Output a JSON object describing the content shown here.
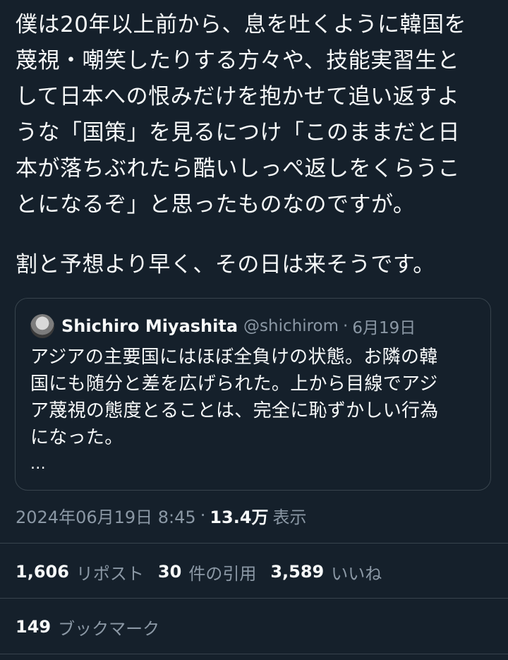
{
  "post": {
    "text_lines": [
      "僕は20年以上前から、息を吐くように韓国を",
      "蔑視・嘲笑したりする方々や、技能実習生と",
      "して日本への恨みだけを抱かせて追い返すよ",
      "うな「国策」を見るにつけ「このままだと日",
      "本が落ちぶれたら酷いしっぺ返しをくらうこ",
      "とになるぞ」と思ったものなのですが。",
      "割と予想より早く、その日は来そうです。"
    ]
  },
  "quote": {
    "author_name": "Shichiro Miyashita",
    "handle": "@shichirom",
    "separator": "·",
    "date": "6月19日",
    "text_lines": [
      "アジアの主要国にはほぼ全負けの状態。お隣の韓",
      "国にも随分と差を広げられた。上から目線でアジ",
      "ア蔑視の態度とることは、完全に恥ずかしい行為",
      "になった。",
      "..."
    ]
  },
  "meta": {
    "timestamp": "2024年06月19日 8:45",
    "separator": "·",
    "views_count": "13.4万",
    "views_label": "表示"
  },
  "stats": {
    "reposts_count": "1,606",
    "reposts_label": "リポスト",
    "quotes_count": "30",
    "quotes_label": "件の引用",
    "likes_count": "3,589",
    "likes_label": "いいね",
    "bookmarks_count": "149",
    "bookmarks_label": "ブックマーク"
  }
}
